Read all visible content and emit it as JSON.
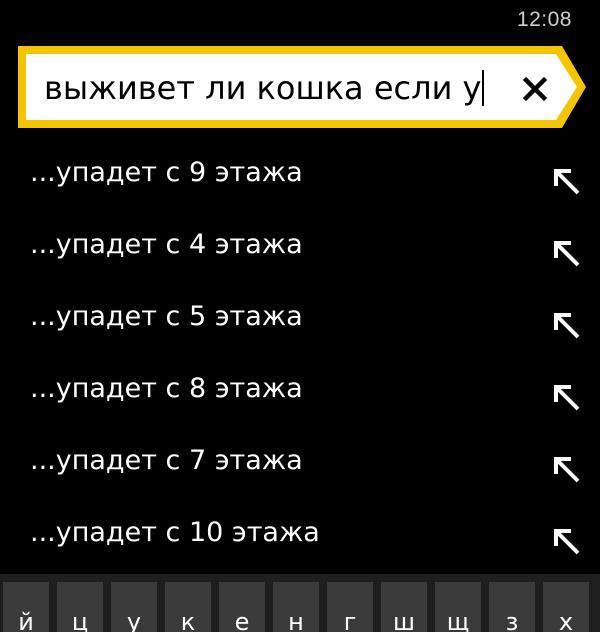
{
  "status_bar": {
    "time": "12:08"
  },
  "search": {
    "query": "выживет ли кошка если у",
    "accent_color": "#f5c400",
    "clear_icon": "close-icon"
  },
  "suggestions": [
    {
      "text": "...упадет с 9 этажа",
      "icon": "arrow-up-left-icon"
    },
    {
      "text": "...упадет с 4 этажа",
      "icon": "arrow-up-left-icon"
    },
    {
      "text": "...упадет с 5 этажа",
      "icon": "arrow-up-left-icon"
    },
    {
      "text": "...упадет с 8 этажа",
      "icon": "arrow-up-left-icon"
    },
    {
      "text": "...упадет с 7 этажа",
      "icon": "arrow-up-left-icon"
    },
    {
      "text": "...упадет с 10 этажа",
      "icon": "arrow-up-left-icon"
    }
  ],
  "keyboard": {
    "keys": [
      "й",
      "ц",
      "у",
      "к",
      "е",
      "н",
      "г",
      "ш",
      "щ",
      "з",
      "х"
    ]
  }
}
